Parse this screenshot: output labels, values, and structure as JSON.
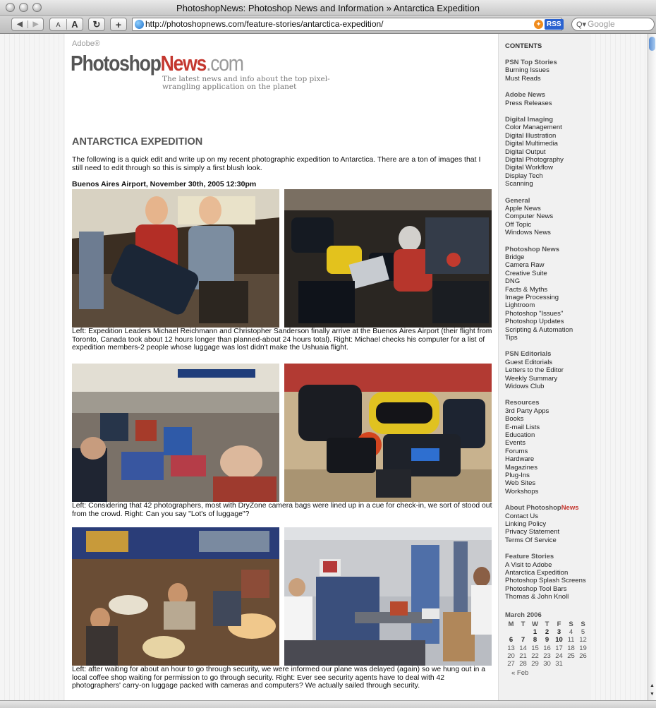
{
  "window": {
    "title": "PhotoshopNews: Photoshop News and Information » Antarctica Expedition"
  },
  "toolbar": {
    "back_icon": "◀",
    "forward_icon": "▶",
    "font_small": "A",
    "font_big": "A",
    "reload_icon": "↻",
    "add_icon": "+",
    "url": "http://photoshopnews.com/feature-stories/antarctica-expedition/",
    "rss_label": "RSS",
    "search_placeholder": "Google"
  },
  "header": {
    "logo_adobe": "Adobe®",
    "logo_photoshop": "Photoshop",
    "logo_news": "News",
    "logo_dotcom": ".com",
    "tagline": "The latest news and info about the top pixel-wrangling application on the planet"
  },
  "article": {
    "title": "ANTARCTICA EXPEDITION",
    "intro": "The following is a quick edit and write up on my recent photographic expedition to Antarctica. There are a ton of images that I still need to edit through so this is simply a first blush look.",
    "dateline": "Buenos Aires Airport, November 30th, 2005 12:30pm",
    "captions": [
      "Left: Expedition Leaders Michael Reichmann and Christopher Sanderson finally arrive at the Buenos Aires Airport (their flight from Toronto, Canada took about 12 hours longer than planned-about 24 hours total). Right: Michael checks his computer for a list of expedition members-2 people whose luggage was lost didn't make the Ushuaia flight.",
      "Left: Considering that 42 photographers, most with DryZone camera bags were lined up in a cue for check-in, we sort of stood out from the crowd. Right: Can you say \"Lot's of luggage\"?",
      "Left: after waiting for about an hour to go through security, we were informed our plane was delayed (again) so we hung out in a local coffee shop waiting for permission to go through security. Right: Ever see security agents have to deal with 42 photographers' carry-on luggage packed with cameras and computers? We actually sailed through security."
    ]
  },
  "sidebar": {
    "contents_label": "CONTENTS",
    "sections": [
      {
        "heading": "PSN Top Stories",
        "items": [
          "Burning Issues",
          "Must Reads"
        ]
      },
      {
        "heading": "Adobe News",
        "items": [
          "Press Releases"
        ]
      },
      {
        "heading": "Digital Imaging",
        "items": [
          "Color Management",
          "Digital Illustration",
          "Digital Multimedia",
          "Digital Output",
          "Digital Photography",
          "Digital Workflow",
          "Display Tech",
          "Scanning"
        ]
      },
      {
        "heading": "General",
        "items": [
          "Apple News",
          "Computer News",
          "Off Topic",
          "Windows News"
        ]
      },
      {
        "heading": "Photoshop News",
        "items": [
          "Bridge",
          "Camera Raw",
          "Creative Suite",
          "DNG",
          "Facts & Myths",
          "Image Processing",
          "Lightroom",
          "Photoshop \"Issues\"",
          "Photoshop Updates",
          "Scripting & Automation",
          "Tips"
        ]
      },
      {
        "heading": "PSN Editorials",
        "items": [
          "Guest Editorials",
          "Letters to the Editor",
          "Weekly Summary",
          "Widows Club"
        ]
      },
      {
        "heading": "Resources",
        "items": [
          "3rd Party Apps",
          "Books",
          "E-mail Lists",
          "Education",
          "Events",
          "Forums",
          "Hardware",
          "Magazines",
          "Plug-Ins",
          "Web Sites",
          "Workshops"
        ]
      },
      {
        "heading": "About Photoshop",
        "heading_red": "News",
        "items": [
          "Contact Us",
          "Linking Policy",
          "Privacy Statement",
          "Terms Of Service"
        ]
      },
      {
        "heading": "Feature Stories",
        "items": [
          "A Visit to Adobe",
          "Antarctica Expedition",
          "Photoshop Splash Screens",
          "Photoshop Tool Bars",
          "Thomas & John Knoll"
        ]
      }
    ],
    "calendar": {
      "month": "March 2006",
      "weekdays": [
        "M",
        "T",
        "W",
        "T",
        "F",
        "S",
        "S"
      ],
      "weeks": [
        [
          "",
          "",
          "1",
          "2",
          "3",
          "4",
          "5"
        ],
        [
          "6",
          "7",
          "8",
          "9",
          "10",
          "11",
          "12"
        ],
        [
          "13",
          "14",
          "15",
          "16",
          "17",
          "18",
          "19"
        ],
        [
          "20",
          "21",
          "22",
          "23",
          "24",
          "25",
          "26"
        ],
        [
          "27",
          "28",
          "29",
          "30",
          "31",
          "",
          ""
        ]
      ],
      "bold_days": [
        "1",
        "2",
        "3",
        "6",
        "7",
        "8",
        "9",
        "10"
      ],
      "prev_link": "« Feb"
    }
  }
}
